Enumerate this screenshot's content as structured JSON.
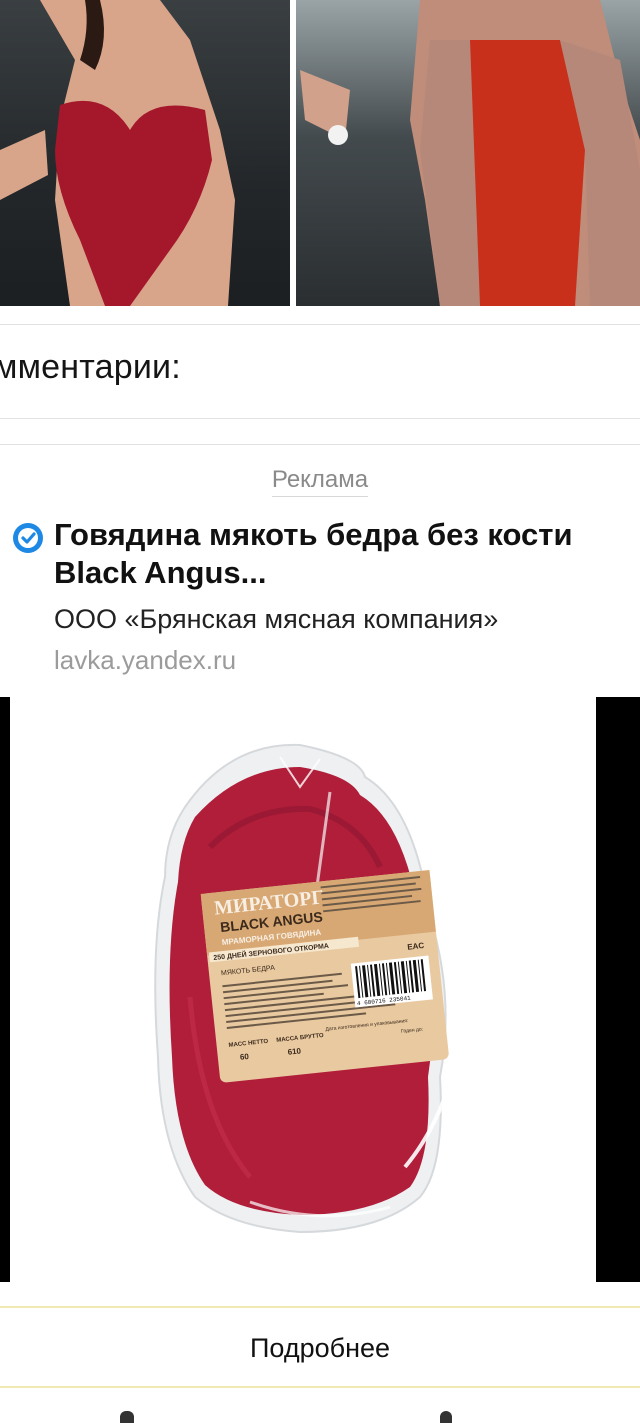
{
  "comments": {
    "title": "мментарии:"
  },
  "ad": {
    "label": "Реклама",
    "verified_icon": "verified-check-icon",
    "title": "Говядина мякоть бедра без кости Black Angus...",
    "advertiser": "ООО «Брянская мясная компания»",
    "domain": "lavka.yandex.ru",
    "image": {
      "brand": "МИРАТОРГ",
      "line": "BLACK ANGUS",
      "subline": "МРАМОРНАЯ ГОВЯДИНА",
      "ribbon": "250 ДНЕЙ ЗЕРНОВОГО ОТКОРМА",
      "product": "МЯКОТЬ БЕДРА",
      "net_label": "МАСС НЕТТО",
      "net_value": "60",
      "gross_label": "МАССА БРУТТО",
      "gross_value": "610",
      "date_label": "Дата изготовления и упаковывания:",
      "sign_label": "Годен до:",
      "barcode_number": "4 600716 235041",
      "eac": "EAC"
    },
    "more_button": "Подробнее"
  },
  "colors": {
    "meat": "#b01e3a",
    "label": "#e9c9a0",
    "accent": "#1e88e5"
  }
}
